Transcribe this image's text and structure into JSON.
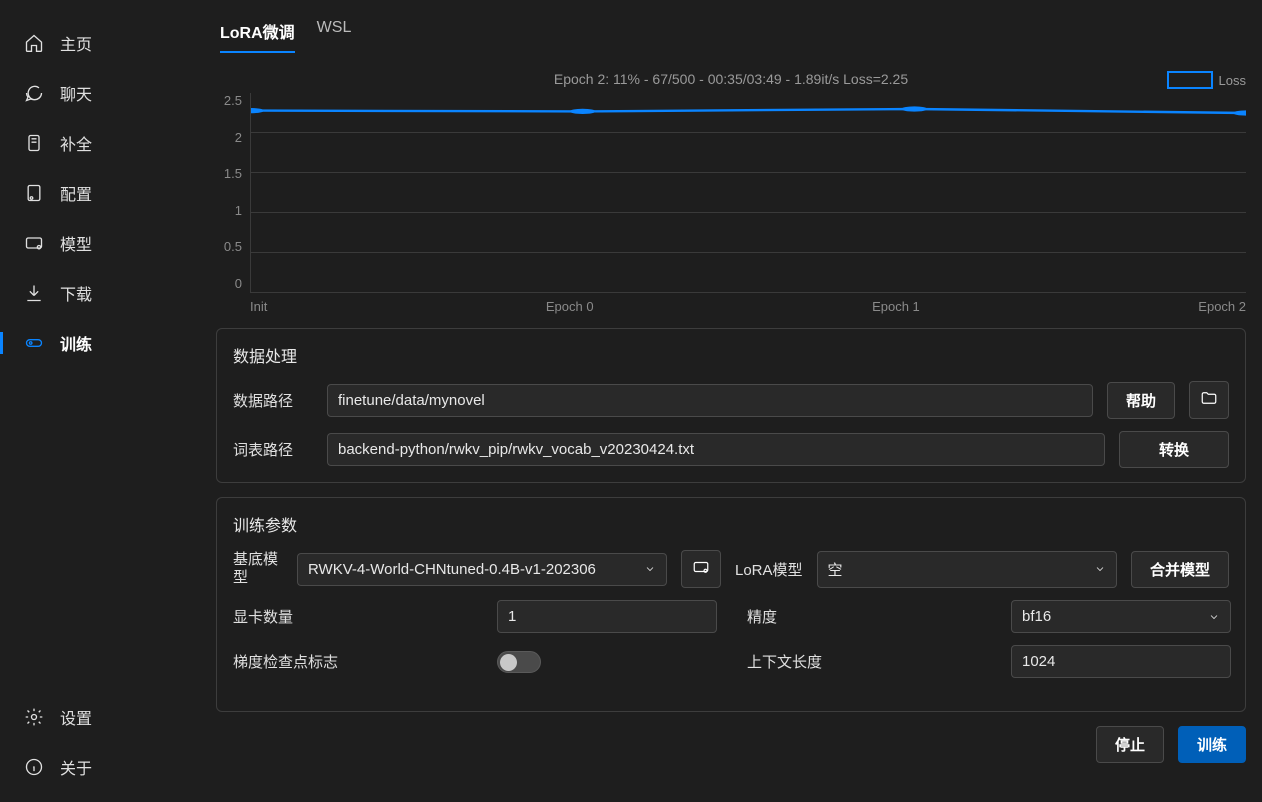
{
  "sidebar": {
    "items": [
      {
        "icon": "home-icon",
        "label": "主页"
      },
      {
        "icon": "chat-icon",
        "label": "聊天"
      },
      {
        "icon": "complete-icon",
        "label": "补全"
      },
      {
        "icon": "config-icon",
        "label": "配置"
      },
      {
        "icon": "model-icon",
        "label": "模型"
      },
      {
        "icon": "download-icon",
        "label": "下载"
      },
      {
        "icon": "train-icon",
        "label": "训练"
      }
    ],
    "bottom": [
      {
        "icon": "settings-icon",
        "label": "设置"
      },
      {
        "icon": "info-icon",
        "label": "关于"
      }
    ],
    "active_index": 6
  },
  "tabs": {
    "items": [
      "LoRA微调",
      "WSL"
    ],
    "active_index": 0
  },
  "chart_data": {
    "type": "line",
    "title": "Epoch 2: 11% - 67/500 - 00:35/03:49 - 1.89it/s Loss=2.25",
    "legend": "Loss",
    "categories": [
      "Init",
      "Epoch 0",
      "Epoch 1",
      "Epoch 2"
    ],
    "values": [
      2.28,
      2.27,
      2.3,
      2.25
    ],
    "ylim": [
      0,
      2.5
    ],
    "yticks": [
      0,
      0.5,
      1.0,
      1.5,
      2.0,
      2.5
    ],
    "ylabel": "",
    "xlabel": ""
  },
  "data_proc": {
    "title": "数据处理",
    "data_path_label": "数据路径",
    "data_path": "finetune/data/mynovel",
    "help": "帮助",
    "vocab_path_label": "词表路径",
    "vocab_path": "backend-python/rwkv_pip/rwkv_vocab_v20230424.txt",
    "convert": "转换"
  },
  "train_params": {
    "title": "训练参数",
    "base_model_label": "基底模型",
    "base_model_value": "RWKV-4-World-CHNtuned-0.4B-v1-202306",
    "lora_model_label": "LoRA模型",
    "lora_model_value": "空",
    "merge_model": "合并模型",
    "gpu_count_label": "显卡数量",
    "gpu_count_value": "1",
    "precision_label": "精度",
    "precision_value": "bf16",
    "grad_ckpt_label": "梯度检查点标志",
    "grad_ckpt_value": false,
    "ctx_len_label": "上下文长度",
    "ctx_len_value": "1024"
  },
  "footer": {
    "stop": "停止",
    "train": "训练"
  }
}
